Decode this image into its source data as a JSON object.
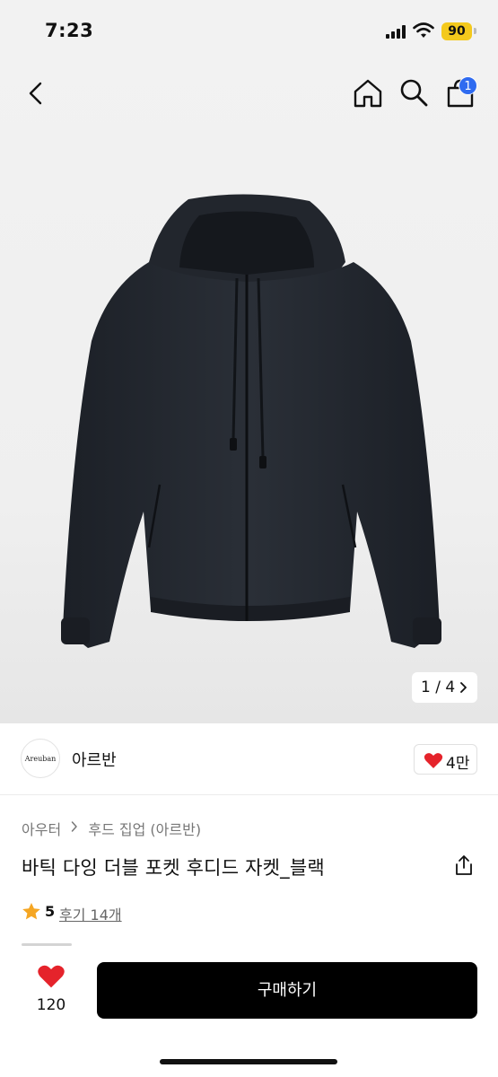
{
  "status_bar": {
    "time": "7:23",
    "battery": "90"
  },
  "nav": {
    "cart_count": "1"
  },
  "gallery": {
    "pager": "1 / 4"
  },
  "brand": {
    "logo_text": "Areuban",
    "name": "아르반",
    "likes": "4만"
  },
  "breadcrumb": [
    "아우터",
    "후드 집업 (아르반)"
  ],
  "product": {
    "title": "바틱 다잉 더블 포켓 후디드 자켓_블랙"
  },
  "rating": {
    "score": "5",
    "reviews": "후기 14개"
  },
  "bottom_bar": {
    "wish_count": "120",
    "buy_label": "구매하기"
  },
  "colors": {
    "accent": "#2f6bf0",
    "heart": "#e5232b",
    "star": "#f5a623",
    "battery": "#f4c91c"
  },
  "icons": [
    "back-icon",
    "home-icon",
    "search-icon",
    "cart-icon",
    "heart-icon",
    "share-icon",
    "star-icon",
    "chevron-right-icon"
  ]
}
